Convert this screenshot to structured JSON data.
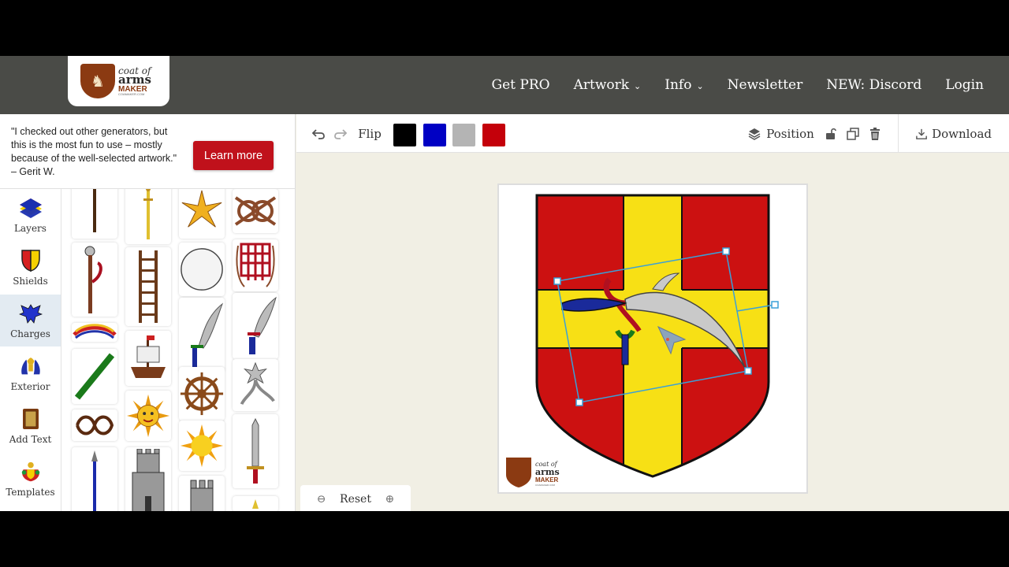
{
  "header": {
    "logo": {
      "line1": "coat of",
      "line2": "arms",
      "line3": "MAKER",
      "line4": "COAMAKER.COM"
    },
    "nav": [
      {
        "label": "Get PRO",
        "dropdown": false
      },
      {
        "label": "Artwork",
        "dropdown": true
      },
      {
        "label": "Info",
        "dropdown": true
      },
      {
        "label": "Newsletter",
        "dropdown": false
      },
      {
        "label": "NEW: Discord",
        "dropdown": false
      },
      {
        "label": "Login",
        "dropdown": false
      }
    ]
  },
  "promo": {
    "quote": "\"I checked out other generators, but this is the most fun to use – mostly because of the well-selected artwork.\" – Gerit W.",
    "button": "Learn more"
  },
  "sidebar": {
    "items": [
      {
        "label": "Layers",
        "icon": "layers-icon"
      },
      {
        "label": "Shields",
        "icon": "shield-icon"
      },
      {
        "label": "Charges",
        "icon": "eagle-icon",
        "active": true
      },
      {
        "label": "Exterior",
        "icon": "mantling-icon"
      },
      {
        "label": "Add Text",
        "icon": "book-icon"
      },
      {
        "label": "Templates",
        "icon": "crest-icon"
      }
    ]
  },
  "toolbar": {
    "flip_label": "Flip",
    "colors": [
      "#000000",
      "#0000c4",
      "#b4b4b4",
      "#c4000a"
    ],
    "position_label": "Position",
    "download_label": "Download"
  },
  "canvas": {
    "reset_label": "Reset",
    "shield_colors": {
      "red": "#cc1111",
      "yellow": "#f7e015"
    }
  }
}
